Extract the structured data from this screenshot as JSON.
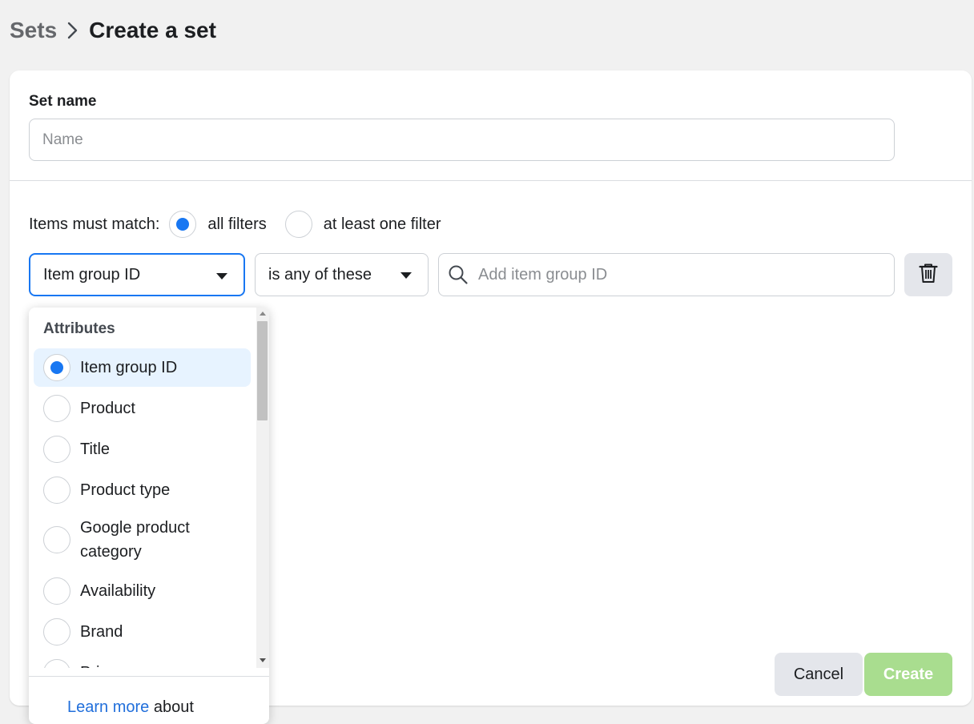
{
  "breadcrumb": {
    "parent": "Sets",
    "current": "Create a set"
  },
  "form": {
    "set_name_label": "Set name",
    "set_name_placeholder": "Name",
    "set_name_value": "",
    "match_label": "Items must match:",
    "match_options": [
      {
        "label": "all filters",
        "checked": true
      },
      {
        "label": "at least one filter",
        "checked": false
      }
    ]
  },
  "filter": {
    "attribute": "Item group ID",
    "operator": "is any of these",
    "search_placeholder": "Add item group ID",
    "search_value": "",
    "delete_icon": "trash-icon"
  },
  "dropdown": {
    "heading": "Attributes",
    "items": [
      {
        "label": "Item group ID",
        "selected": true
      },
      {
        "label": "Product",
        "selected": false
      },
      {
        "label": "Title",
        "selected": false
      },
      {
        "label": "Product type",
        "selected": false
      },
      {
        "label": "Google product category",
        "selected": false
      },
      {
        "label": "Availability",
        "selected": false
      },
      {
        "label": "Brand",
        "selected": false
      },
      {
        "label": "Price",
        "selected": false
      }
    ],
    "learn_more_link": "Learn more",
    "learn_more_text": "about"
  },
  "actions": {
    "cancel_label": "Cancel",
    "create_label": "Create"
  },
  "colors": {
    "accent": "#1877f2",
    "create_disabled": "#a9dd8f",
    "link": "#216fdb"
  }
}
